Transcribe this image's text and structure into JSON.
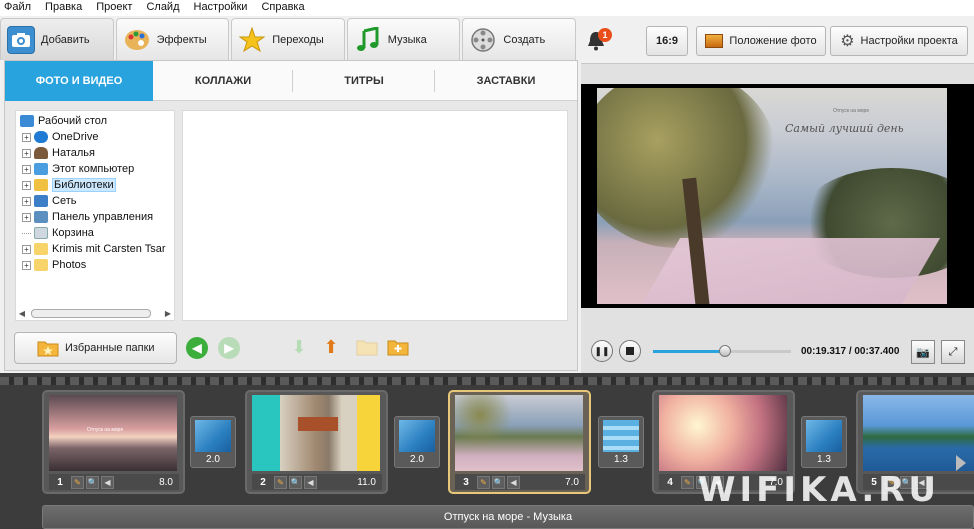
{
  "menu": [
    "Файл",
    "Правка",
    "Проект",
    "Слайд",
    "Настройки",
    "Справка"
  ],
  "main_tabs": [
    {
      "label": "Добавить",
      "icon": "camera-icon",
      "active": true
    },
    {
      "label": "Эффекты",
      "icon": "palette-icon",
      "active": false
    },
    {
      "label": "Переходы",
      "icon": "star-icon",
      "active": false
    },
    {
      "label": "Музыка",
      "icon": "music-note-icon",
      "active": false
    },
    {
      "label": "Создать",
      "icon": "film-reel-icon",
      "active": false
    }
  ],
  "sub_tabs": [
    {
      "label": "ФОТО И ВИДЕО",
      "active": true
    },
    {
      "label": "КОЛЛАЖИ",
      "active": false
    },
    {
      "label": "ТИТРЫ",
      "active": false
    },
    {
      "label": "ЗАСТАВКИ",
      "active": false
    }
  ],
  "tree": [
    {
      "label": "Рабочий стол",
      "toggle": "",
      "icon": "desktop-icon"
    },
    {
      "label": "OneDrive",
      "toggle": "+",
      "icon": "cloud-icon"
    },
    {
      "label": "Наталья",
      "toggle": "+",
      "icon": "user-icon"
    },
    {
      "label": "Этот компьютер",
      "toggle": "+",
      "icon": "computer-icon"
    },
    {
      "label": "Библиотеки",
      "toggle": "+",
      "icon": "libraries-icon",
      "selected": true
    },
    {
      "label": "Сеть",
      "toggle": "+",
      "icon": "network-icon"
    },
    {
      "label": "Панель управления",
      "toggle": "+",
      "icon": "control-panel-icon"
    },
    {
      "label": "Корзина",
      "toggle": "",
      "icon": "recycle-bin-icon"
    },
    {
      "label": "Krimis mit Carsten Tsar",
      "toggle": "+",
      "icon": "folder-icon"
    },
    {
      "label": "Photos",
      "toggle": "+",
      "icon": "folder-icon"
    }
  ],
  "favorites_button": "Избранные папки",
  "notifications": {
    "count": "1"
  },
  "aspect_button": "16:9",
  "photo_position_button": "Положение фото",
  "project_settings_button": "Настройки проекта",
  "player": {
    "time": "00:19.317 / 00:37.400",
    "progress_fraction": 0.52,
    "video_caption": "Самый лучший день",
    "video_subcaption": "Отпуск на море"
  },
  "slides": [
    {
      "num": "1",
      "duration": "8.0",
      "active": false
    },
    {
      "num": "2",
      "duration": "11.0",
      "active": false
    },
    {
      "num": "3",
      "duration": "7.0",
      "active": true
    },
    {
      "num": "4",
      "duration": "7.0",
      "active": false
    },
    {
      "num": "5",
      "duration": "",
      "active": false
    }
  ],
  "transitions": [
    "2.0",
    "2.0",
    "1.3",
    "1.3"
  ],
  "slide1_caption": "Отпуск на море",
  "music_track": "Отпуск на море - Музыка",
  "watermark": "WIFIKA.RU",
  "colors": {
    "accent": "#29a3dd",
    "active_slide": "#e8c77a",
    "badge": "#e94e1b"
  }
}
